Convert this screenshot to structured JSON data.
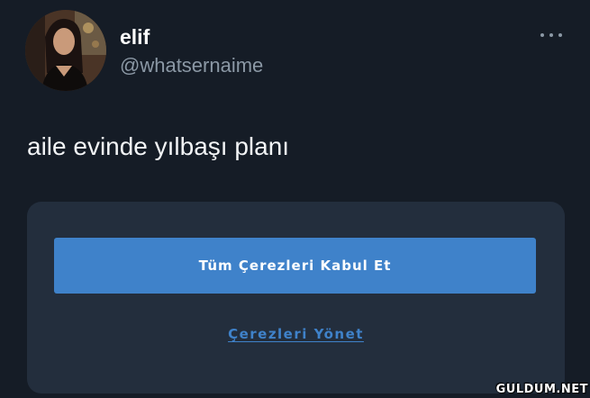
{
  "tweet": {
    "author_name": "elif",
    "author_handle": "@whatsernaime",
    "text": "aile evinde yılbaşı planı",
    "avatar_icon": "profile-photo",
    "more_icon": "more-options-icon"
  },
  "cookie_banner": {
    "accept_all_label": "Tüm Çerezleri Kabul Et",
    "manage_label": "Çerezleri Yönet"
  },
  "watermark": "GULDUM.NET",
  "colors": {
    "background": "#151c26",
    "card": "#232e3d",
    "accent": "#3f82ca",
    "handle": "#8b98a5"
  }
}
